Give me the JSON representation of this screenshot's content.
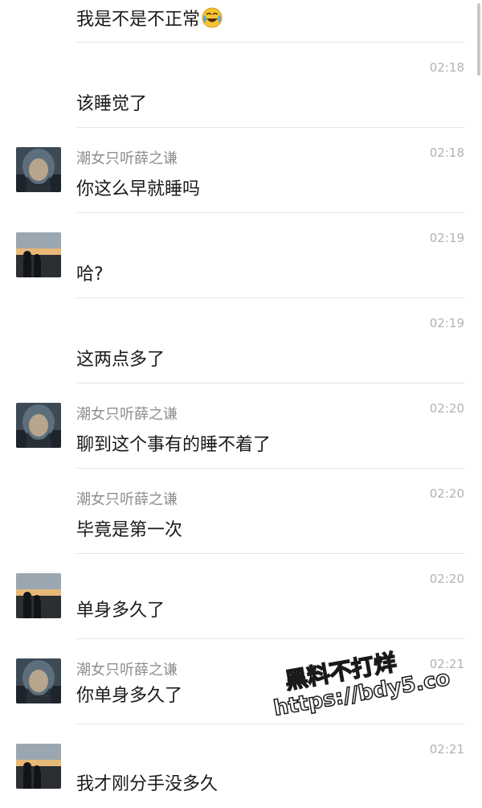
{
  "messages": [
    {
      "sender": "",
      "time": "",
      "text": "我是不是不正常",
      "emoji": "crying-laughing-face",
      "avatar": null
    },
    {
      "sender": "",
      "time": "02:18",
      "text": "该睡觉了",
      "avatar": null
    },
    {
      "sender": "潮女只听薛之谦",
      "time": "02:18",
      "text": "你这么早就睡吗",
      "avatar": "hooded-person"
    },
    {
      "sender": "",
      "time": "02:19",
      "text": "哈?",
      "avatar": "sunset-couple"
    },
    {
      "sender": "",
      "time": "02:19",
      "text": "这两点多了",
      "avatar": null
    },
    {
      "sender": "潮女只听薛之谦",
      "time": "02:20",
      "text": "聊到这个事有的睡不着了",
      "avatar": "hooded-person"
    },
    {
      "sender": "潮女只听薛之谦",
      "time": "02:20",
      "text": "毕竟是第一次",
      "avatar": null
    },
    {
      "sender": "",
      "time": "02:20",
      "text": "单身多久了",
      "avatar": "sunset-couple"
    },
    {
      "sender": "潮女只听薛之谦",
      "time": "02:21",
      "text": "你单身多久了",
      "avatar": "hooded-person"
    },
    {
      "sender": "",
      "time": "02:21",
      "text": "我才刚分手没多久",
      "avatar": "sunset-couple"
    }
  ],
  "watermark": {
    "line1": "黑料不打烊",
    "line2": "https://bdy5.co"
  },
  "colors": {
    "text": "#1a1a1a",
    "sender": "#8e8e8e",
    "time": "#b2b2b2",
    "divider": "#e6e6e6"
  }
}
